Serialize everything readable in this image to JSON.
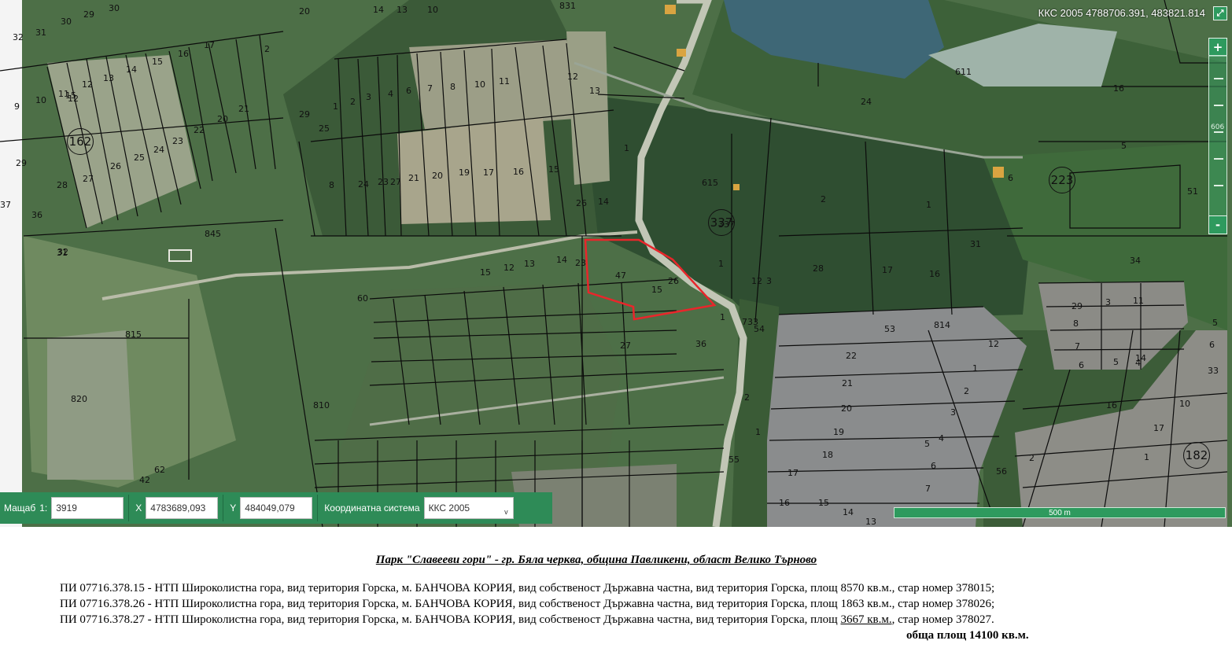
{
  "map": {
    "coordinate_readout": "ККС 2005 4788706.391, 483821.814",
    "zoom": {
      "plus_label": "+",
      "minus_label": "-",
      "level_label": "606"
    },
    "scale_bar_label": "500 m",
    "highlight_color": "#e8262b",
    "parcel_numbers": [
      "31",
      "30",
      "29",
      "30",
      "14",
      "13",
      "10",
      "831",
      "32",
      "9",
      "10",
      "11",
      "12",
      "13",
      "14",
      "15",
      "16",
      "17",
      "2",
      "15",
      "12",
      "20",
      "21",
      "22",
      "23",
      "24",
      "25",
      "26",
      "27",
      "28",
      "29",
      "36",
      "37",
      "31",
      "8",
      "24",
      "23",
      "27",
      "21",
      "20",
      "19",
      "17",
      "16",
      "15",
      "12",
      "13",
      "1",
      "2",
      "3",
      "4",
      "6",
      "7",
      "8",
      "10",
      "11",
      "20",
      "29",
      "25",
      "26",
      "14",
      "1",
      "615",
      "337",
      "1",
      "2",
      "1",
      "28",
      "17",
      "16",
      "12",
      "3",
      "24",
      "611",
      "16",
      "5",
      "6",
      "51",
      "31",
      "34",
      "845",
      "32",
      "60",
      "815",
      "820",
      "810",
      "62",
      "42",
      "15",
      "12",
      "13",
      "14",
      "23",
      "47",
      "15",
      "26",
      "27",
      "1",
      "733",
      "54",
      "53",
      "22",
      "21",
      "20",
      "19",
      "18",
      "17",
      "16",
      "15",
      "14",
      "13",
      "12",
      "1",
      "2",
      "3",
      "4",
      "5",
      "6",
      "7",
      "29",
      "8",
      "7",
      "6",
      "5",
      "4",
      "3",
      "2",
      "1",
      "10",
      "11",
      "14",
      "16",
      "17",
      "2",
      "1",
      "55",
      "36",
      "56",
      "814",
      "33",
      "6",
      "5",
      "4",
      "3"
    ],
    "circled_numbers": [
      "162",
      "337",
      "223",
      "182"
    ]
  },
  "toolbar": {
    "scale_label": "Мащаб",
    "scale_prefix": "1:",
    "scale_value": "3919",
    "x_label": "X",
    "x_value": "4783689,093",
    "y_label": "Y",
    "y_value": "484049,079",
    "crs_label": "Координатна система",
    "crs_value": "ККС 2005",
    "crs_arrow": "v"
  },
  "document": {
    "title": "Парк \"Славееви гори\" - гр. Бяла черква, община Павликени, област Велико Търново",
    "line1": "ПИ 07716.378.15 - НТП Широколистна гора, вид територия Горска, м. БАНЧОВА КОРИЯ, вид собственост Държавна частна, вид територия Горска, площ 8570 кв.м., стар номер 378015;",
    "line2": "ПИ 07716.378.26 - НТП Широколистна гора, вид територия Горска, м. БАНЧОВА КОРИЯ, вид собственост Държавна частна, вид територия Горска, площ 1863 кв.м., стар номер 378026;",
    "line3_a": "ПИ 07716.378.27 - НТП Широколистна гора, вид територия Горска, м. БАНЧОВА КОРИЯ, вид собственост Държавна частна, вид територия Горска, площ ",
    "line3_b": "3667 кв.м.",
    "line3_c": ", стар номер 378027.",
    "total": "обща площ 14100 кв.м."
  }
}
